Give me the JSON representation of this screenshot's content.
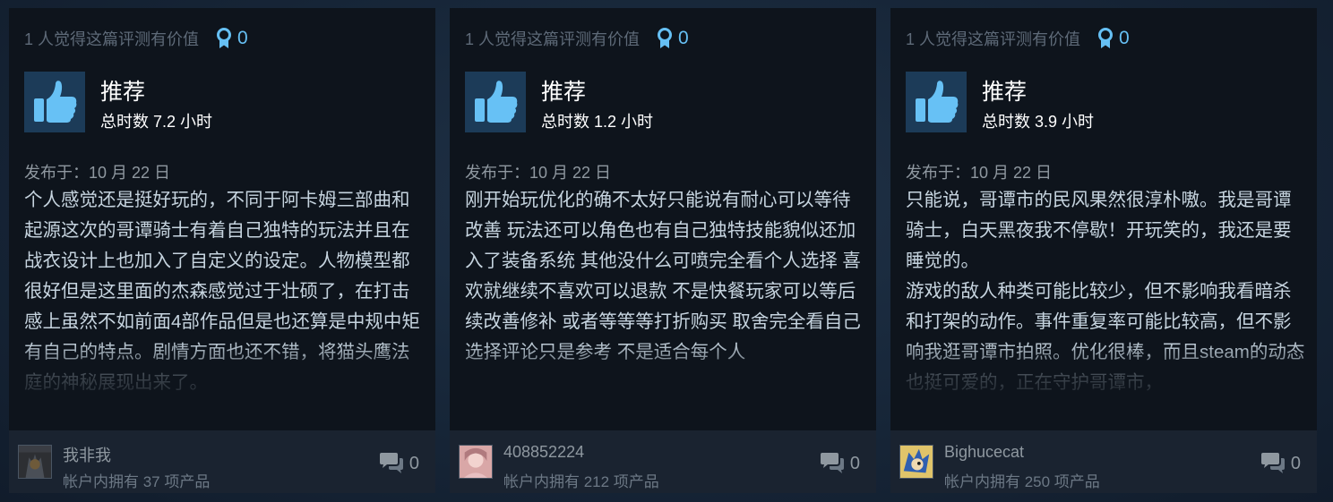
{
  "reviews": [
    {
      "helpful_text": "1 人觉得这篇评测有价值",
      "award_count": "0",
      "recommendation": "推荐",
      "hours": "总时数 7.2 小时",
      "posted": "发布于：10 月 22 日",
      "body": "个人感觉还是挺好玩的，不同于阿卡姆三部曲和起源这次的哥谭骑士有着自己独特的玩法并且在战衣设计上也加入了自定义的设定。人物模型都很好但是这里面的杰森感觉过于壮硕了，在打击感上虽然不如前面4部作品但是也还算是中规中矩有自己的特点。剧情方面也还不错，将猫头鹰法庭的神秘展现出来了。",
      "author": "我非我",
      "products": "帐户内拥有 37 项产品",
      "comment_count": "0",
      "avatar_icon": "dark-knight-avatar"
    },
    {
      "helpful_text": "1 人觉得这篇评测有价值",
      "award_count": "0",
      "recommendation": "推荐",
      "hours": "总时数 1.2 小时",
      "posted": "发布于：10 月 22 日",
      "body": "刚开始玩优化的确不太好只能说有耐心可以等待改善 玩法还可以角色也有自己独特技能貌似还加入了装备系统 其他没什么可喷完全看个人选择 喜欢就继续不喜欢可以退款 不是快餐玩家可以等后续改善修补 或者等等等打折购买 取舍完全看自己选择评论只是参考 不是适合每个人",
      "author": "408852224",
      "products": "帐户内拥有 212 项产品",
      "comment_count": "0",
      "avatar_icon": "pink-portrait-avatar"
    },
    {
      "helpful_text": "1 人觉得这篇评测有价值",
      "award_count": "0",
      "recommendation": "推荐",
      "hours": "总时数 3.9 小时",
      "posted": "发布于：10 月 22 日",
      "body": "只能说，哥谭市的民风果然很淳朴嗷。我是哥谭骑士，白天黑夜我不停歇！开玩笑的，我还是要睡觉的。\n游戏的敌人种类可能比较少，但不影响我看暗杀和打架的动作。事件重复率可能比较高，但不影响我逛哥谭市拍照。优化很棒，而且steam的动态也挺可爱的，正在守护哥谭市，",
      "author": "Bighucecat",
      "products": "帐户内拥有 250 项产品",
      "comment_count": "0",
      "avatar_icon": "blue-hedgehog-avatar"
    }
  ],
  "colors": {
    "card_bg": "#0e141c",
    "footer_bg": "#1a2330",
    "accent_blue": "#66c0f4",
    "thumb_bg": "#1c3b58",
    "body_text": "#c6d4df",
    "muted_text": "#8f98a0"
  }
}
